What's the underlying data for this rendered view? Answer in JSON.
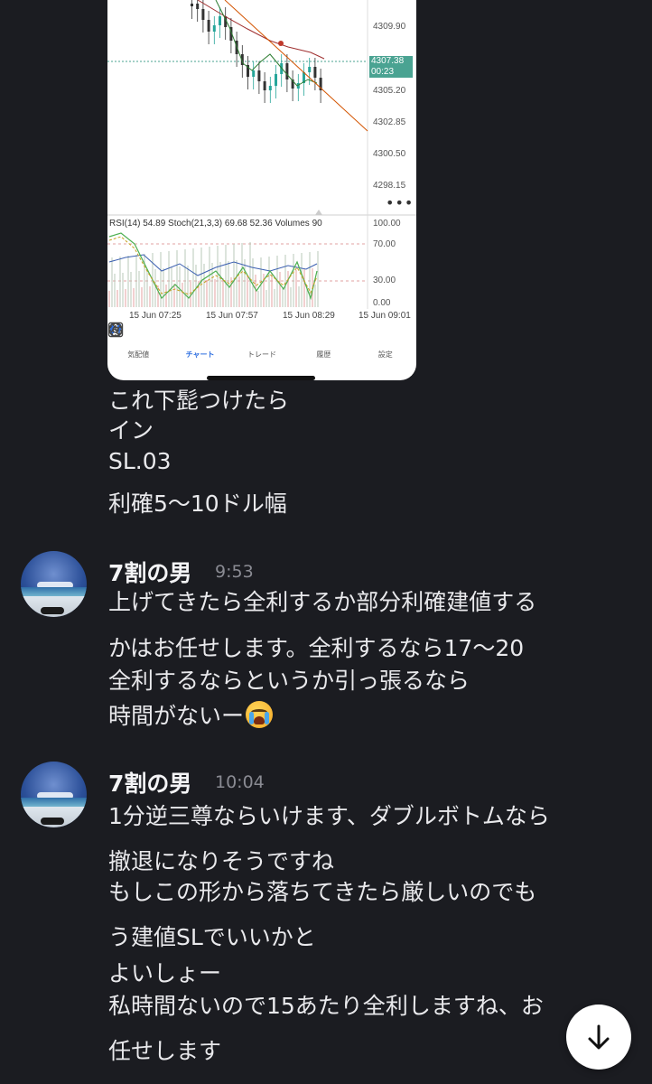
{
  "chart": {
    "price_labels": [
      "4309.90",
      "4305.20",
      "4302.85",
      "4300.50",
      "4298.15"
    ],
    "current_price": "4307.38",
    "current_countdown": "00:23",
    "more_label": "•••",
    "indicator_label": "RSI(14) 54.89 Stoch(21,3,3) 69.68 52.36 Volumes 90",
    "osc_labels": [
      "100.00",
      "70.00",
      "30.00",
      "0.00"
    ],
    "time_labels": [
      "15 Jun 07:25",
      "15 Jun 07:57",
      "15 Jun 08:29",
      "15 Jun 09:01"
    ],
    "up_color": "#26a69a",
    "down_color": "#333333",
    "trend_color": "#c0392b"
  },
  "tabs": [
    {
      "label": "気配値",
      "icon": "quotes-icon"
    },
    {
      "label": "チャート",
      "icon": "candlestick-icon"
    },
    {
      "label": "トレード",
      "icon": "trade-chart-icon"
    },
    {
      "label": "履歴",
      "icon": "history-icon"
    },
    {
      "label": "設定",
      "icon": "settings-gear-icon"
    }
  ],
  "message0": {
    "lines": [
      "これ下髭つけたら",
      "イン",
      "SL.03",
      "利確5〜10ドル幅"
    ]
  },
  "message1": {
    "sender": "7割の男",
    "time": "9:53",
    "lines": [
      "上げてきたら全利するか部分利確建値する",
      "かはお任せします。全利するなら17〜20",
      "全利するならというか引っ張るなら",
      "時間がないー"
    ],
    "emoji": "loudly-crying-face-emoji"
  },
  "message2": {
    "sender": "7割の男",
    "time": "10:04",
    "lines": [
      "1分逆三尊ならいけます、ダブルボトムなら",
      "撤退になりそうですね",
      "もしこの形から落ちてきたら厳しいのでも",
      "う建値SLでいいかと",
      "よいしょー",
      "私時間ないので15あたり全利しますね、お",
      "任せします"
    ]
  },
  "scroll_button": {
    "icon": "arrow-down-icon"
  }
}
